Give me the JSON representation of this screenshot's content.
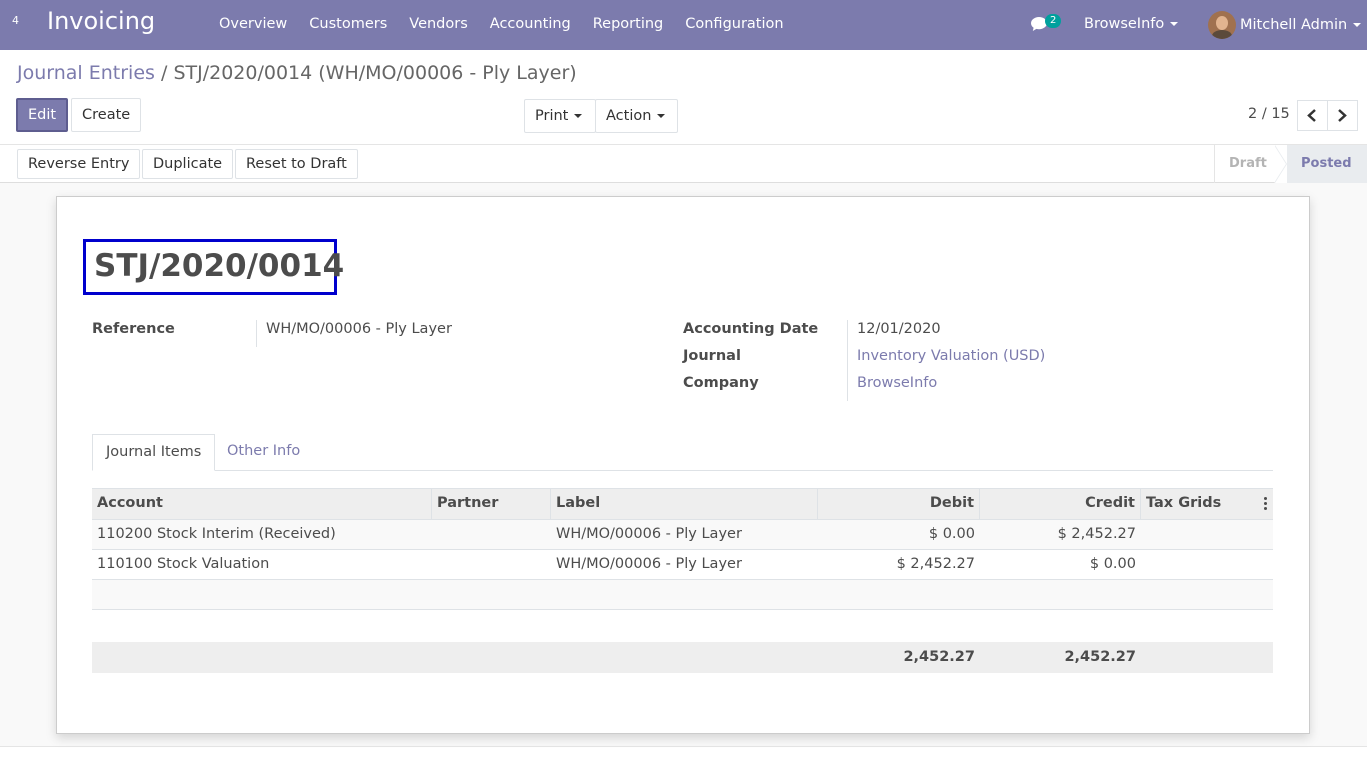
{
  "navbar": {
    "apps_label": "4",
    "brand": "Invoicing",
    "menu": [
      "Overview",
      "Customers",
      "Vendors",
      "Accounting",
      "Reporting",
      "Configuration"
    ],
    "chat_count": "2",
    "company": "BrowseInfo",
    "user": "Mitchell Admin"
  },
  "breadcrumb": {
    "parent": "Journal Entries",
    "separator": "/",
    "current": "STJ/2020/0014 (WH/MO/00006 - Ply Layer)"
  },
  "toolbar": {
    "edit": "Edit",
    "create": "Create",
    "print": "Print",
    "action": "Action",
    "pager": "2 / 15"
  },
  "statusbar": {
    "reverse": "Reverse Entry",
    "duplicate": "Duplicate",
    "reset": "Reset to Draft",
    "steps": [
      "Draft",
      "Posted"
    ]
  },
  "form": {
    "name": "STJ/2020/0014",
    "reference_label": "Reference",
    "reference": "WH/MO/00006 - Ply Layer",
    "date_label": "Accounting Date",
    "date": "12/01/2020",
    "journal_label": "Journal",
    "journal": "Inventory Valuation (USD)",
    "company_label": "Company",
    "company": "BrowseInfo"
  },
  "tabs": [
    "Journal Items",
    "Other Info"
  ],
  "table": {
    "headers": [
      "Account",
      "Partner",
      "Label",
      "Debit",
      "Credit",
      "Tax Grids"
    ],
    "rows": [
      {
        "account": "110200 Stock Interim (Received)",
        "partner": "",
        "label": "WH/MO/00006 - Ply Layer",
        "debit": "$ 0.00",
        "credit": "$ 2,452.27"
      },
      {
        "account": "110100 Stock Valuation",
        "partner": "",
        "label": "WH/MO/00006 - Ply Layer",
        "debit": "$ 2,452.27",
        "credit": "$ 0.00"
      }
    ],
    "total_debit": "2,452.27",
    "total_credit": "2,452.27"
  },
  "colors": {
    "brand": "#7c7bad",
    "highlight_box": "#0000cd",
    "badge": "#00a09d"
  }
}
